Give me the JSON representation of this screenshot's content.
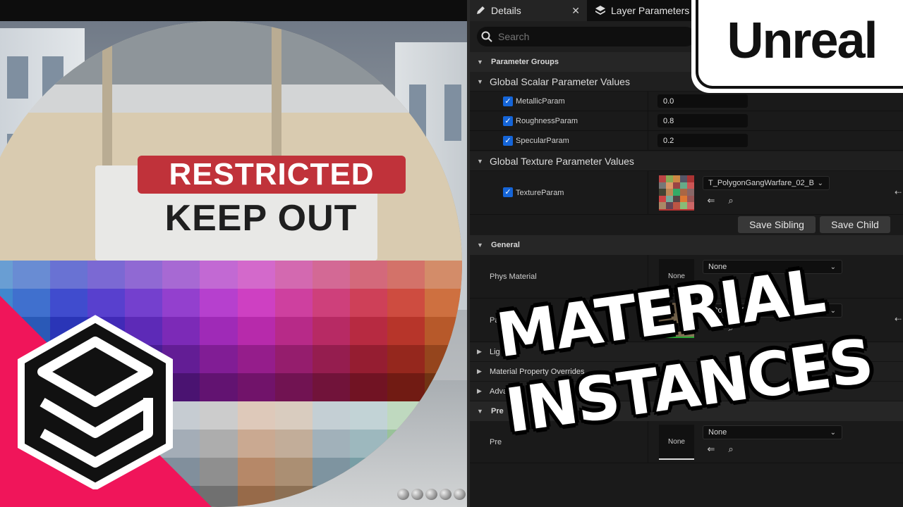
{
  "tabs": [
    {
      "label": "Details",
      "icon": "pencil-icon",
      "close": "✕"
    },
    {
      "label": "Layer Parameters",
      "icon": "layers-icon"
    }
  ],
  "search": {
    "placeholder": "Search"
  },
  "sections": {
    "parameter_groups": "Parameter Groups",
    "global_scalar": "Global Scalar Parameter Values",
    "global_texture": "Global Texture Parameter Values",
    "general": "General"
  },
  "scalar_params": [
    {
      "label": "MetallicParam",
      "value": "0.0",
      "checked": true
    },
    {
      "label": "RoughnessParam",
      "value": "0.8",
      "checked": true
    },
    {
      "label": "SpecularParam",
      "value": "0.2",
      "checked": true
    }
  ],
  "texture_param": {
    "label": "TextureParam",
    "checked": true,
    "asset": "T_PolygonGangWarfare_02_B"
  },
  "buttons": {
    "save_sibling": "Save Sibling",
    "save_child": "Save Child"
  },
  "general": {
    "phys_material_label": "Phys Material",
    "phys_material_value": "None",
    "phys_thumb_text": "None",
    "parent_label_partial": "Pa",
    "parent_value_partial": "_PolygonGangWarfare_01_A"
  },
  "collapsed_sections": {
    "lightmass": "Lig",
    "material_property_overrides": "Material Property Overrides",
    "advanced": "Advanced",
    "previewing": "Pre"
  },
  "preview": {
    "label_partial": "Pre",
    "thumb_text": "None",
    "value": "None"
  },
  "sign": {
    "line1": "RESTRICTED",
    "line2": "KEEP OUT"
  },
  "overlay": {
    "badge": "Unreal",
    "headline_line1": "MATERIAL",
    "headline_line2": "INSTANCES"
  },
  "colors": {
    "accent_pink": "#f0155a",
    "checkbox_blue": "#1565d8",
    "panel_bg": "#1a1a1a",
    "sign_red": "#c0323a"
  }
}
